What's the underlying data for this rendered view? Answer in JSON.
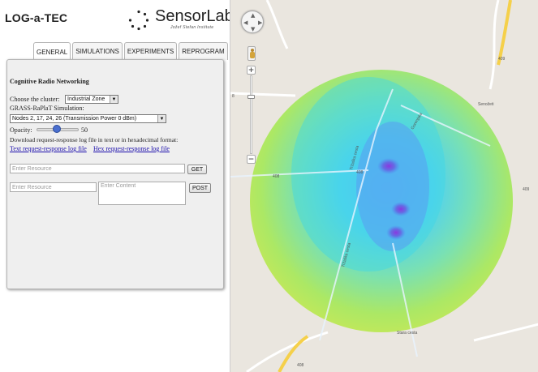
{
  "header": {
    "app_title": "LOG-a-TEC",
    "logo_text": "SensorLab",
    "logo_subtext": "Jožef Stefan Institute"
  },
  "tabs": [
    {
      "label": "GENERAL",
      "active": true
    },
    {
      "label": "SIMULATIONS",
      "active": false
    },
    {
      "label": "EXPERIMENTS",
      "active": false
    },
    {
      "label": "REPROGRAM",
      "active": false
    }
  ],
  "panel": {
    "heading": "Cognitive Radio Networking",
    "cluster_label": "Choose the cluster:",
    "cluster_value": "Industrial Zone",
    "simulation_label": "GRASS-RaPlaT Simulation:",
    "simulation_value": "Nodes 2, 17, 24, 26 (Transmission Power 0 dBm)",
    "opacity_label": "Opacity:",
    "opacity_value": "50",
    "download_label": "Download request-response log file in text or in hexadecimal format:",
    "text_log_link": "Text request-response log file",
    "hex_log_link": "Hex request-response log file",
    "get_resource_placeholder": "Enter Resource",
    "get_button": "GET",
    "post_resource_placeholder": "Enter Resource",
    "post_content_placeholder": "Enter Content",
    "post_button": "POST"
  },
  "map": {
    "road_labels": [
      "409",
      "8",
      "408",
      "408",
      "408",
      "409",
      "Tržaška cesta",
      "Tržaška cesta",
      "Gorenjska",
      "Senožeti",
      "Stara cesta"
    ],
    "coverage_colors": {
      "high": "#6a3dd8",
      "mid": "#45d0f0",
      "low": "#a6e85a",
      "edge": "#c8e84a"
    }
  }
}
